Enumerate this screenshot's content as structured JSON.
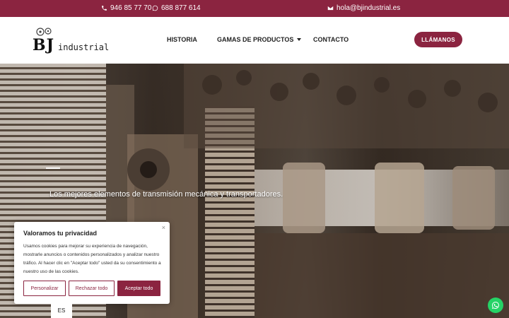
{
  "topbar": {
    "phone1": "946 85 77 70",
    "phone2": "688 877 614",
    "email": "hola@bjindustrial.es"
  },
  "logo": {
    "main": "BJ",
    "sub": "industrial"
  },
  "nav": {
    "historia": "HISTORIA",
    "productos": "GAMAS DE PRODUCTOS",
    "contacto": "CONTACTO"
  },
  "cta": {
    "label": "LLÁMANOS"
  },
  "hero": {
    "tagline": "Los mejores elementos de transmisión mecánica y transportadores."
  },
  "cookie": {
    "title": "Valoramos tu privacidad",
    "body": "Usamos cookies para mejorar su experiencia de navegación, mostrarle anuncios o contenidos personalizados y analizar nuestro tráfico. Al hacer clic en \"Aceptar todo\" usted da su consentimiento a nuestro uso de las cookies.",
    "customize": "Personalizar",
    "reject": "Rechazar todo",
    "accept": "Aceptar todo",
    "close": "×"
  },
  "language": {
    "current": "ES"
  },
  "colors": {
    "brand": "#8b2440",
    "whatsapp": "#25d366"
  }
}
